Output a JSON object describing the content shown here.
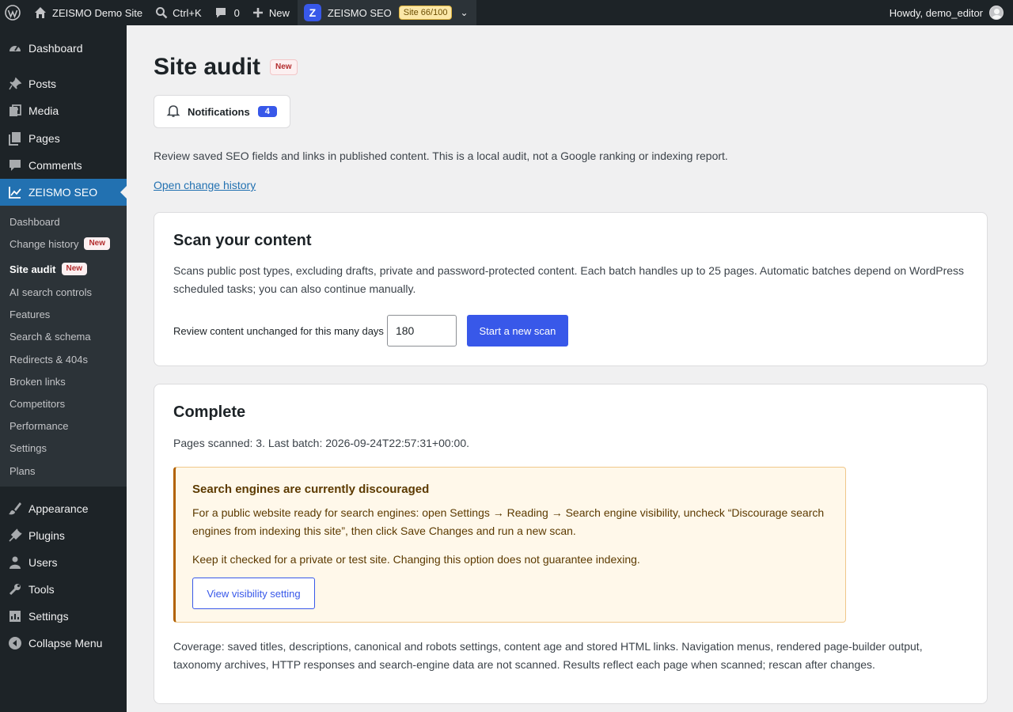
{
  "admin_bar": {
    "site_name": "ZEISMO Demo Site",
    "search_shortcut": "Ctrl+K",
    "comments_count": "0",
    "new_label": "New",
    "plugin_name": "ZEISMO SEO",
    "site_score": "Site 66/100",
    "greeting": "Howdy, demo_editor"
  },
  "sidebar": {
    "menu": [
      {
        "label": "Dashboard",
        "icon": "dashboard-icon"
      },
      {
        "label": "Posts",
        "icon": "pin-icon"
      },
      {
        "label": "Media",
        "icon": "media-icon"
      },
      {
        "label": "Pages",
        "icon": "pages-icon"
      },
      {
        "label": "Comments",
        "icon": "comment-icon"
      },
      {
        "label": "ZEISMO SEO",
        "icon": "chart-icon"
      }
    ],
    "submenu": [
      {
        "label": "Dashboard"
      },
      {
        "label": "Change history",
        "badge": "New"
      },
      {
        "label": "Site audit",
        "badge": "New"
      },
      {
        "label": "AI search controls"
      },
      {
        "label": "Features"
      },
      {
        "label": "Search & schema"
      },
      {
        "label": "Redirects & 404s"
      },
      {
        "label": "Broken links"
      },
      {
        "label": "Competitors"
      },
      {
        "label": "Performance"
      },
      {
        "label": "Settings"
      },
      {
        "label": "Plans"
      }
    ],
    "menu_bottom": [
      {
        "label": "Appearance",
        "icon": "brush-icon"
      },
      {
        "label": "Plugins",
        "icon": "plugin-icon"
      },
      {
        "label": "Users",
        "icon": "user-icon"
      },
      {
        "label": "Tools",
        "icon": "wrench-icon"
      },
      {
        "label": "Settings",
        "icon": "settings-icon"
      },
      {
        "label": "Collapse Menu",
        "icon": "collapse-icon"
      }
    ]
  },
  "page": {
    "title": "Site audit",
    "title_badge": "New",
    "notifications_label": "Notifications",
    "notifications_count": "4",
    "intro": "Review saved SEO fields and links in published content. This is a local audit, not a Google ranking or indexing report.",
    "history_link": "Open change history"
  },
  "scan_card": {
    "heading": "Scan your content",
    "description": "Scans public post types, excluding drafts, private and password-protected content. Each batch handles up to 25 pages. Automatic batches depend on WordPress scheduled tasks; you can also continue manually.",
    "days_label": "Review content unchanged for this many days",
    "days_value": "180",
    "start_button": "Start a new scan"
  },
  "status_card": {
    "heading": "Complete",
    "summary": "Pages scanned: 3. Last batch: 2026-09-24T22:57:31+00:00.",
    "notice": {
      "title": "Search engines are currently discouraged",
      "body": "For a public website ready for search engines: open Settings → Reading → Search engine visibility, uncheck “Discourage search engines from indexing this site”, then click Save Changes and run a new scan.",
      "note": "Keep it checked for a private or test site. Changing this option does not guarantee indexing.",
      "button": "View visibility setting"
    },
    "coverage": "Coverage: saved titles, descriptions, canonical and robots settings, content age and stored HTML links. Navigation menus, rendered page-builder output, taxonomy archives, HTTP responses and search-engine data are not scanned. Results reflect each page when scanned; rescan after changes."
  },
  "colors": {
    "admin_bg": "#1d2327",
    "accent": "#3858e9",
    "current_menu": "#2271b1",
    "notice_bg": "#fff8ea",
    "notice_border": "#b26200"
  }
}
